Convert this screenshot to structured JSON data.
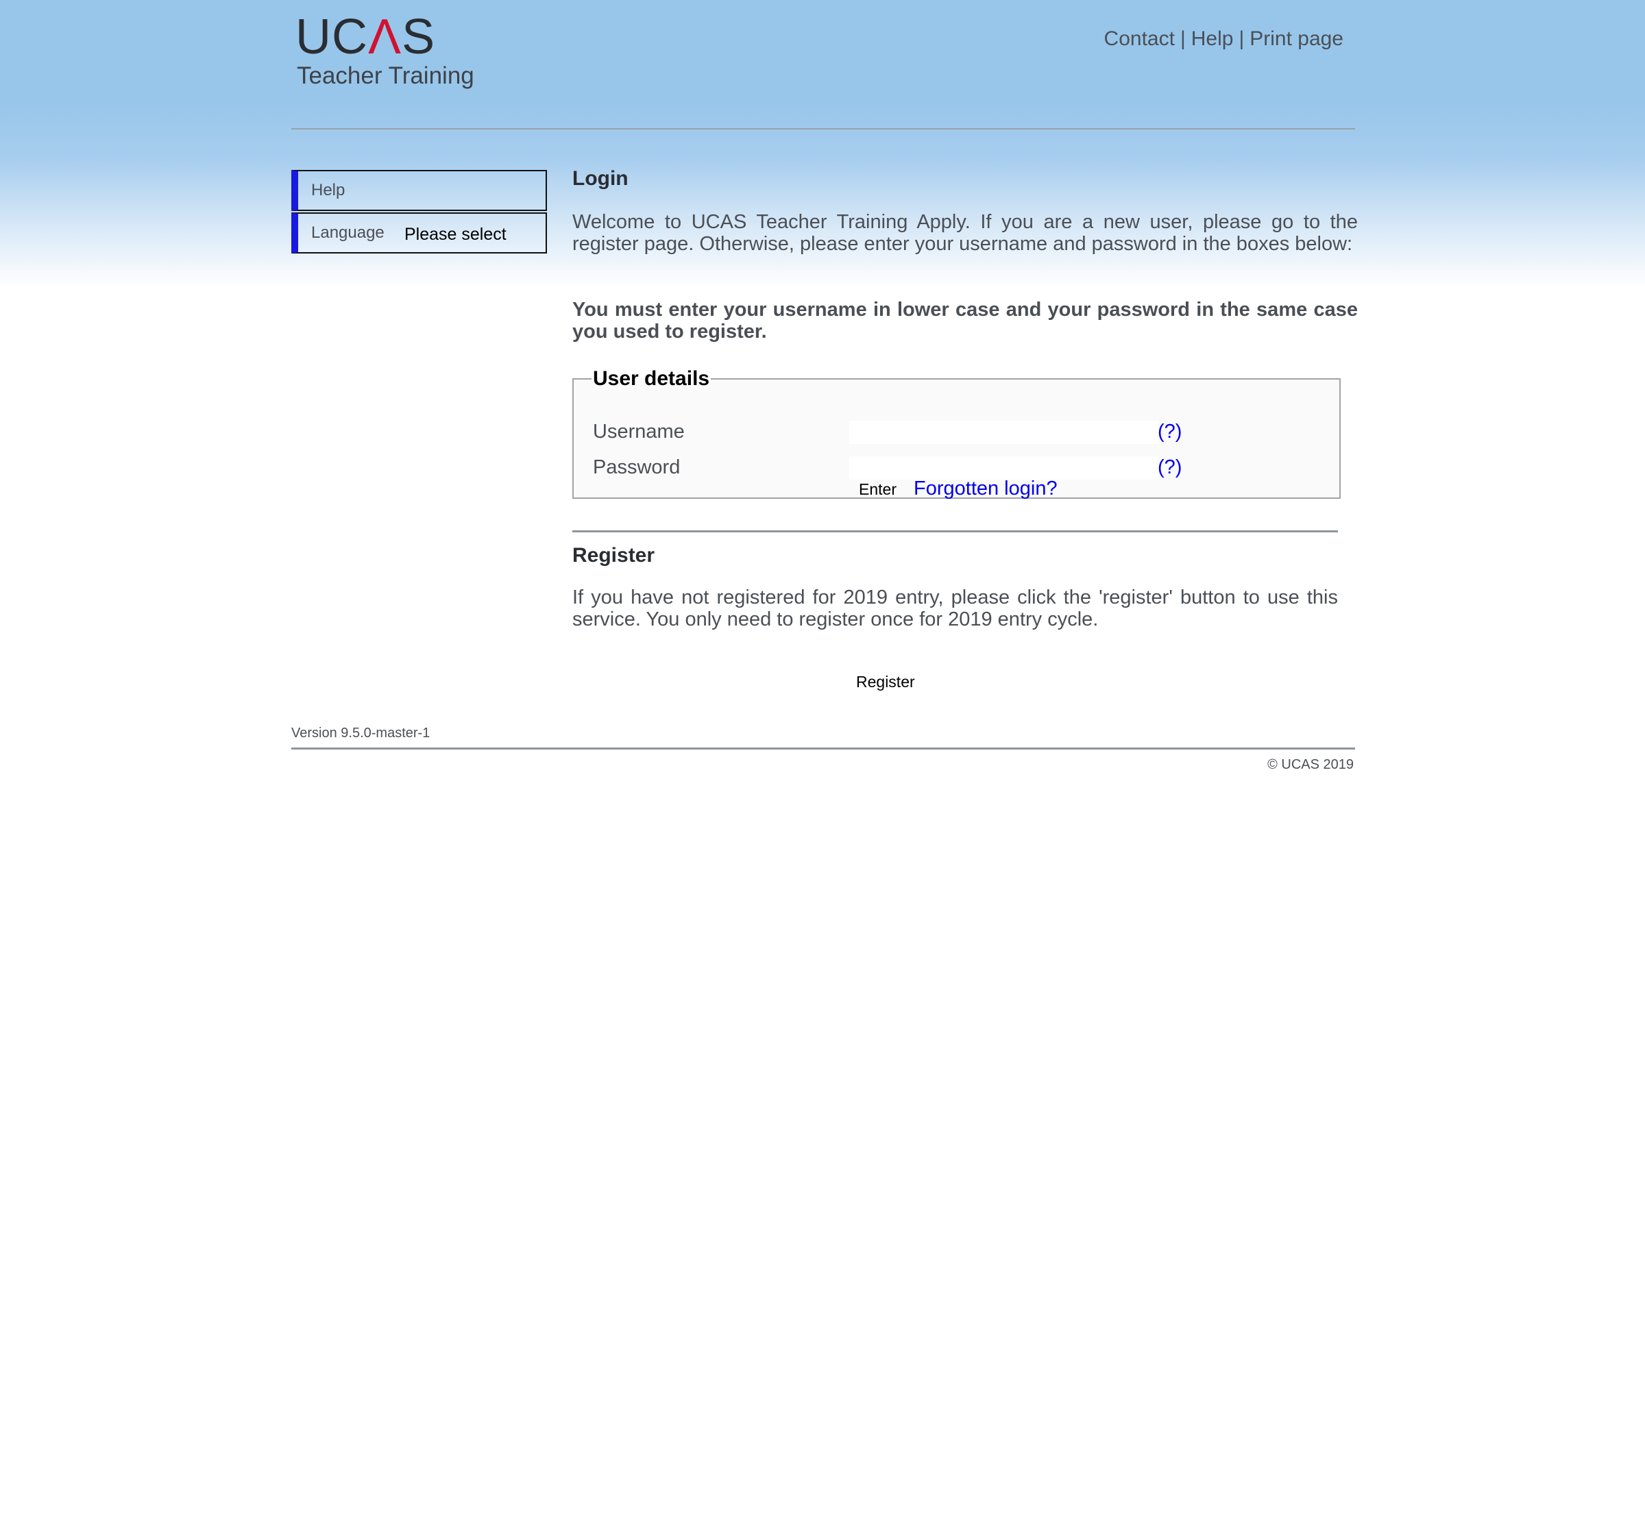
{
  "header": {
    "logo_main": "UCAS",
    "logo_sub": "Teacher Training",
    "links": [
      "Contact",
      "Help",
      "Print page"
    ],
    "separator": "|"
  },
  "sidebar": {
    "items": [
      {
        "label": "Help"
      },
      {
        "label": "Language",
        "select_value": "Please select"
      }
    ],
    "accent_color": "#1919e0"
  },
  "login": {
    "title": "Login",
    "welcome": "Welcome to UCAS Teacher Training Apply. If you are a new user, please go to the register page. Otherwise, please enter your username and password in the boxes below:",
    "note": "You must enter your username in lower case and your password in the same case you used to register.",
    "fieldset_legend": "User details",
    "username_label": "Username",
    "username_value": "",
    "password_label": "Password",
    "password_value": "",
    "help_link": "(?)",
    "enter_button": "Enter",
    "forgot_link": "Forgotten login?"
  },
  "register": {
    "title": "Register",
    "text": "If you have not registered for 2019 entry, please click the 'register' button to use this service. You only need to register once for 2019 entry cycle.",
    "button": "Register"
  },
  "footer": {
    "version": "Version 9.5.0-master-1",
    "copyright": "© UCAS 2019"
  }
}
